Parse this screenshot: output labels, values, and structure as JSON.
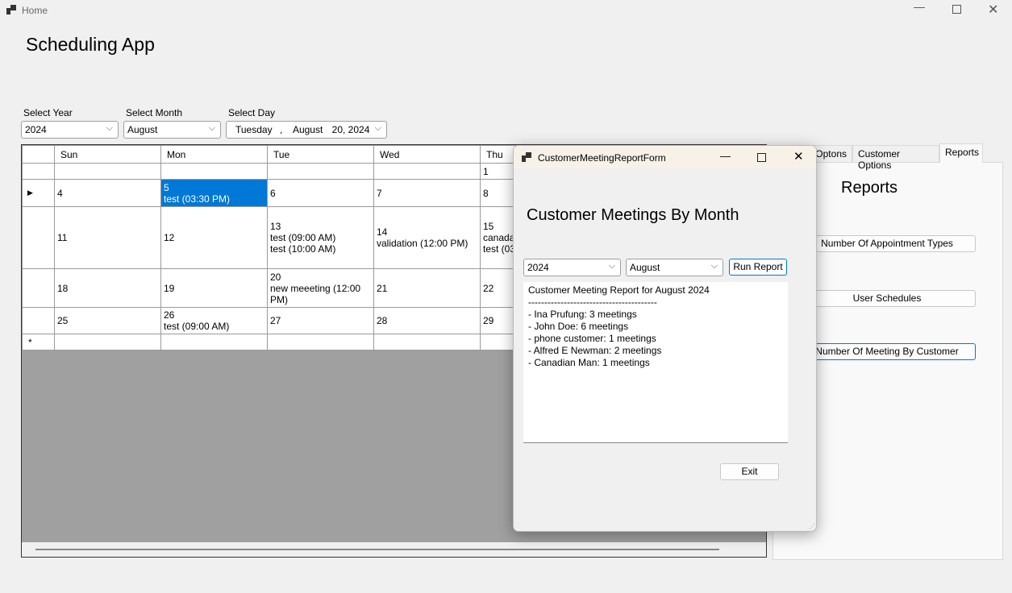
{
  "window": {
    "title": "Home"
  },
  "app": {
    "title": "Scheduling App"
  },
  "filters": {
    "year_label": "Select Year",
    "year_value": "2024",
    "month_label": "Select Month",
    "month_value": "August",
    "day_label": "Select Day",
    "day_weekday": "Tuesday",
    "day_sep": ",",
    "day_month": "August",
    "day_date": "20, 2024"
  },
  "calendar": {
    "headers": [
      "Sun",
      "Mon",
      "Tue",
      "Wed",
      "Thu"
    ],
    "rows": [
      [
        "",
        "",
        "",
        "",
        "1"
      ],
      [
        "4",
        "5\ntest (03:30 PM)",
        "6",
        "7",
        "8"
      ],
      [
        "11",
        "12",
        "13\ntest (09:00 AM)\ntest (10:00 AM)",
        "14\nvalidation (12:00 PM)",
        "15\ncanada\ntest (03"
      ],
      [
        "18",
        "19",
        "20\nnew meeeting (12:00 PM)",
        "21",
        "22"
      ],
      [
        "25",
        "26\ntest (09:00 AM)",
        "27",
        "28",
        "29"
      ]
    ],
    "new_row_marker": "*",
    "current_row_marker": "▶"
  },
  "tabs": {
    "items": [
      "Optons",
      "Customer Options",
      "Reports"
    ],
    "selected": "Reports"
  },
  "reports": {
    "title": "Reports",
    "buttons": [
      "Number Of Appointment Types",
      "User Schedules",
      "Number Of Meeting By Customer"
    ]
  },
  "dialog": {
    "title": "CustomerMeetingReportForm",
    "heading": "Customer Meetings By Month",
    "year_value": "2024",
    "month_value": "August",
    "run_label": "Run Report",
    "exit_label": "Exit",
    "report_lines": [
      "Customer Meeting Report for August 2024",
      "----------------------------------------",
      "- Ina Prufung: 3 meetings",
      "- John Doe: 6 meetings",
      "- phone customer: 1 meetings",
      "- Alfred E Newman: 2 meetings",
      "- Canadian Man: 1 meetings"
    ]
  },
  "colors": {
    "selection": "#0078d7",
    "dialog_titlebar": "#f7f1e8"
  }
}
